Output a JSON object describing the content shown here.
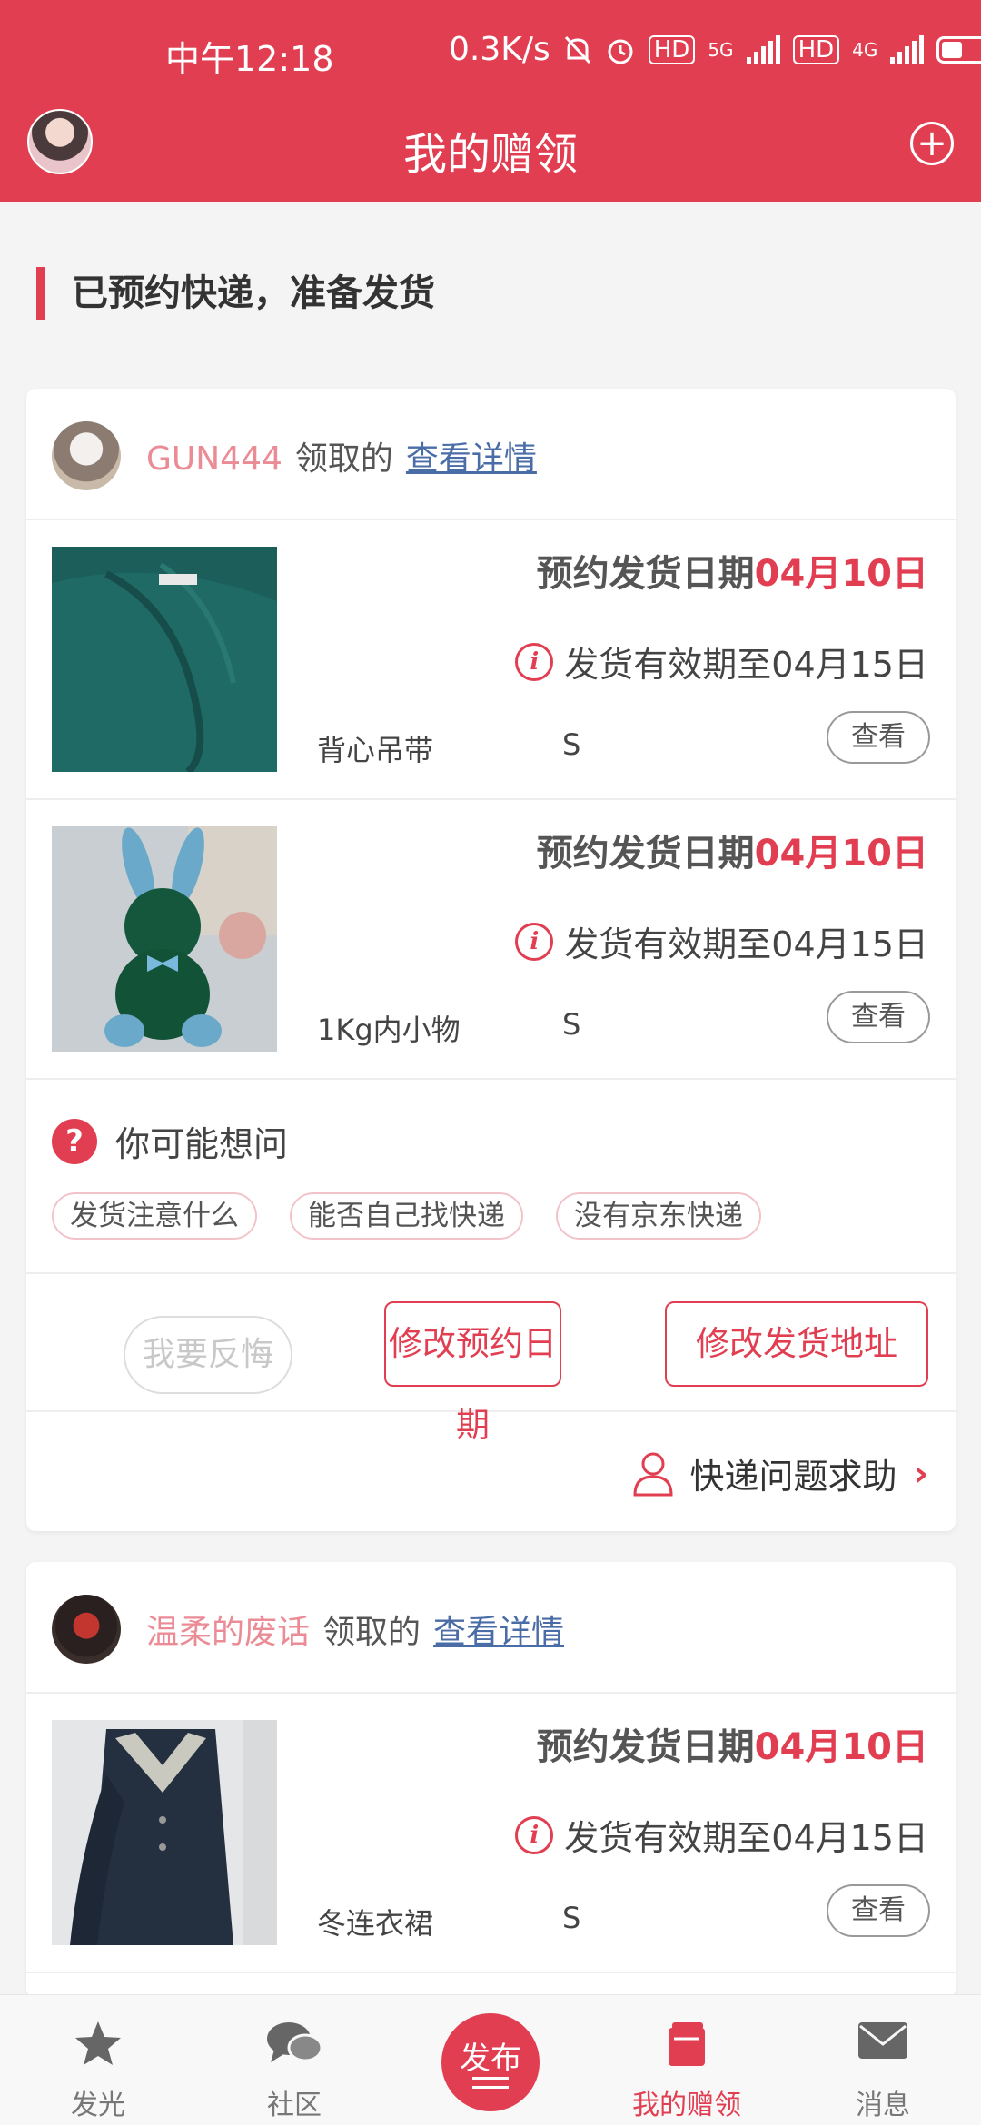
{
  "status": {
    "time": "中午12:18",
    "speed": "0.3K/s",
    "hd": "HD",
    "net1": "5G",
    "net2": "4G"
  },
  "header": {
    "title": "我的赠领",
    "add_symbol": "+"
  },
  "section": {
    "title": "已预约快递，准备发货"
  },
  "common": {
    "claimed": "领取的",
    "view_detail": "查看详情",
    "date_prefix": "预约发货日期",
    "valid_prefix": "发货有效期至",
    "view": "查看",
    "info_glyph": "i"
  },
  "cards": [
    {
      "user": "GUN444",
      "items": [
        {
          "date": "04月10日",
          "valid": "04月15日",
          "name": "背心吊带",
          "size": "S"
        },
        {
          "date": "04月10日",
          "valid": "04月15日",
          "name": "1Kg内小物",
          "size": "S"
        }
      ],
      "faq": {
        "icon": "?",
        "question": "你可能想问",
        "chips": [
          "发货注意什么",
          "能否自己找快递",
          "没有京东快递"
        ]
      },
      "actions": {
        "regret": "我要反悔",
        "change_date": "修改预约日期",
        "change_address": "修改发货地址"
      },
      "help": {
        "label": "快递问题求助",
        "chevron": "›"
      }
    },
    {
      "user": "温柔的废话",
      "items": [
        {
          "date": "04月10日",
          "valid": "04月15日",
          "name": "冬连衣裙",
          "size": "S"
        }
      ]
    }
  ],
  "tabbar": {
    "tabs": [
      {
        "label": "发光",
        "icon": "star-icon"
      },
      {
        "label": "社区",
        "icon": "chat-bubbles-icon"
      },
      {
        "label": "发布",
        "icon": "publish-icon"
      },
      {
        "label": "我的赠领",
        "icon": "gift-book-icon"
      },
      {
        "label": "消息",
        "icon": "mail-icon"
      }
    ]
  },
  "colors": {
    "brand_red": "#e23e52",
    "username_pink": "#ea8b95",
    "link_blue": "#4a6ca7"
  }
}
